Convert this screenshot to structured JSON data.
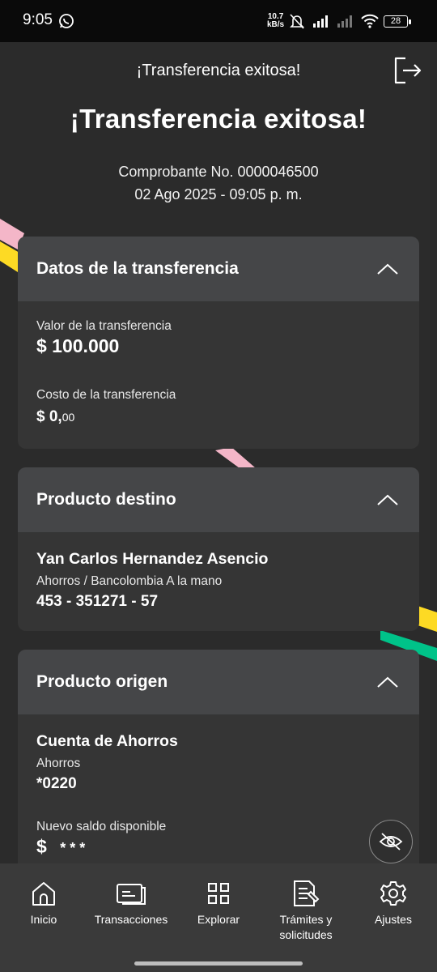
{
  "status_bar": {
    "time": "9:05",
    "net_speed_value": "10.7",
    "net_speed_unit": "kB/s",
    "battery": "28",
    "icons": [
      "whatsapp-icon",
      "mute-icon",
      "signal-icon",
      "signal-icon-2",
      "wifi-icon",
      "battery-icon"
    ]
  },
  "header": {
    "small_title": "¡Transferencia exitosa!",
    "title": "¡Transferencia exitosa!",
    "receipt": "Comprobante No. 0000046500",
    "datetime": "02 Ago 2025 - 09:05 p. m."
  },
  "transfer_card": {
    "title": "Datos de la transferencia",
    "amount_label": "Valor de la transferencia",
    "amount_value": "$ 100.000",
    "cost_label": "Costo de la transferencia",
    "cost_value_main": "$ 0,",
    "cost_value_cents": "00"
  },
  "destination_card": {
    "title": "Producto destino",
    "name": "Yan Carlos Hernandez Asencio",
    "account_type": "Ahorros / Bancolombia A la mano",
    "account_number": "453 - 351271 - 57"
  },
  "origin_card": {
    "title": "Producto origen",
    "account_name": "Cuenta de Ahorros",
    "account_type": "Ahorros",
    "account_number": "*0220",
    "balance_label": "Nuevo saldo disponible",
    "balance_currency": "$",
    "balance_hidden": "* * *"
  },
  "bottom_nav": [
    {
      "label": "Inicio",
      "icon": "home-icon"
    },
    {
      "label": "Transacciones",
      "icon": "card-icon"
    },
    {
      "label": "Explorar",
      "icon": "grid-icon"
    },
    {
      "label": "Trámites y solicitudes",
      "icon": "document-icon"
    },
    {
      "label": "Ajustes",
      "icon": "gear-icon"
    }
  ],
  "colors": {
    "background": "#2b2b2b",
    "card": "#353535",
    "card_header": "#454648",
    "accent_yellow": "#fdda24",
    "accent_pink": "#f4b6c8",
    "accent_green": "#00c389"
  }
}
